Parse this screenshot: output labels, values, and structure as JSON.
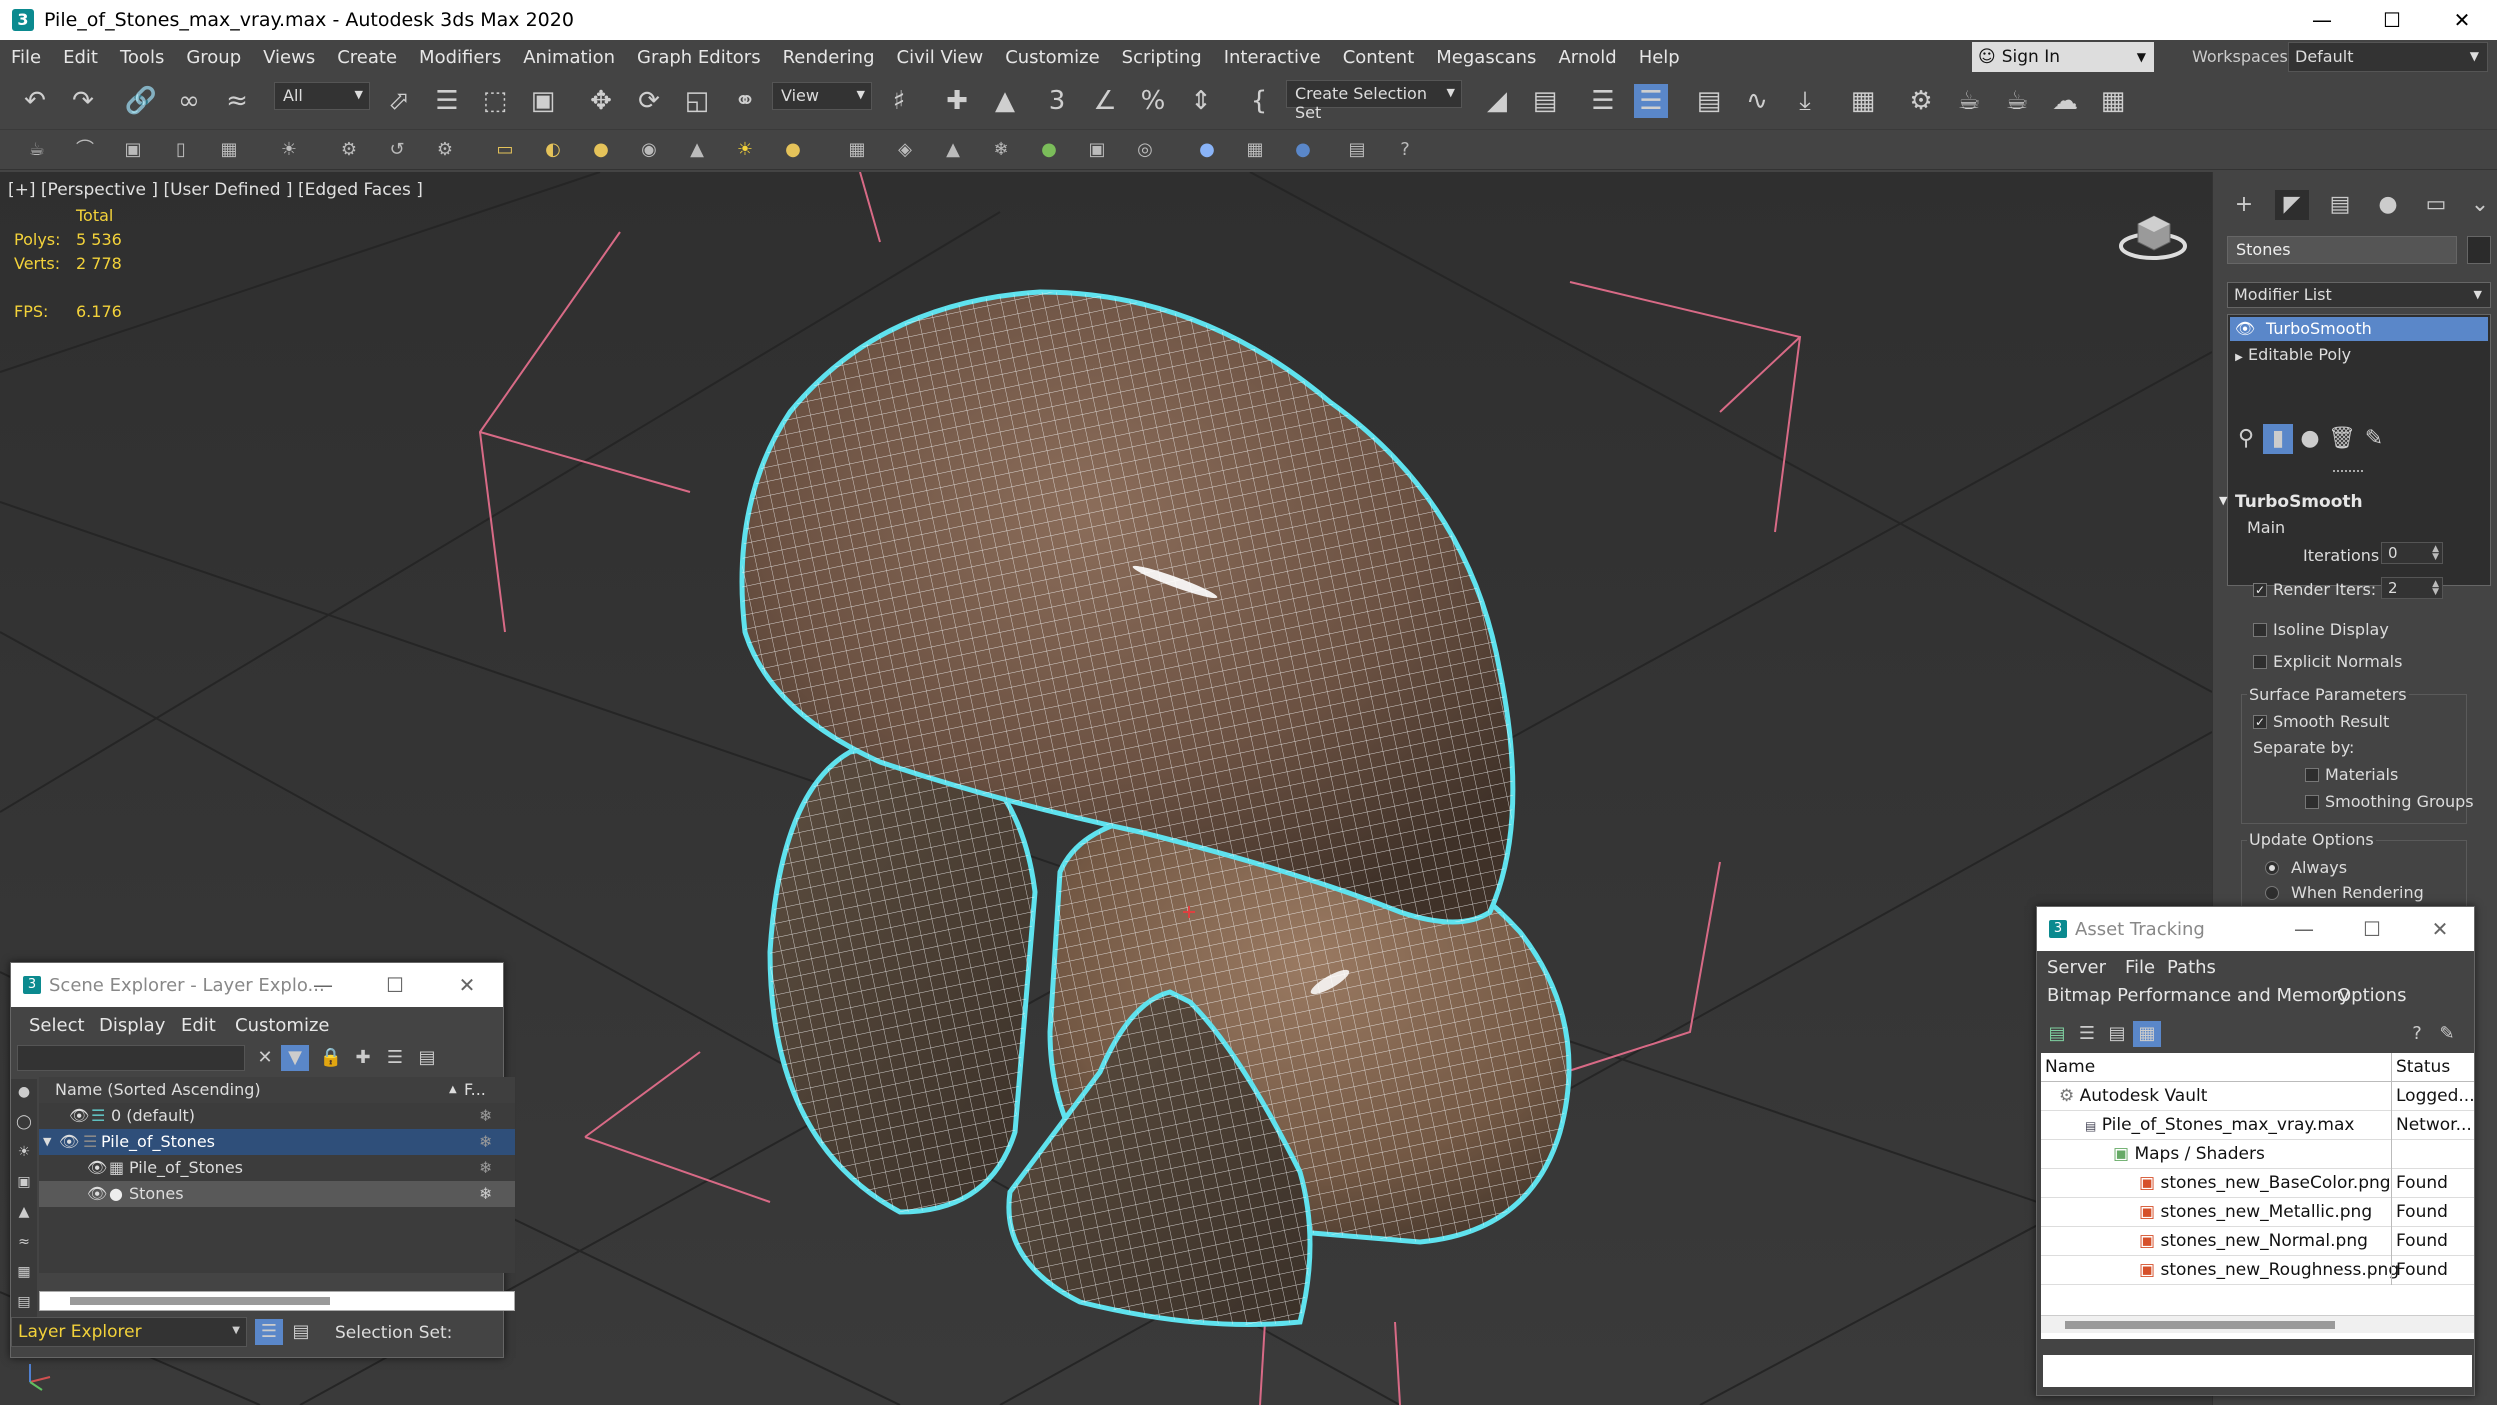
{
  "window": {
    "title": "Pile_of_Stones_max_vray.max - Autodesk 3ds Max 2020",
    "app_icon": "3"
  },
  "menu": [
    "File",
    "Edit",
    "Tools",
    "Group",
    "Views",
    "Create",
    "Modifiers",
    "Animation",
    "Graph Editors",
    "Rendering",
    "Civil View",
    "Customize",
    "Scripting",
    "Interactive",
    "Content",
    "Megascans",
    "Arnold",
    "Help"
  ],
  "signin": {
    "label": "Sign In"
  },
  "workspaces": {
    "label": "Workspaces:",
    "value": "Default"
  },
  "toolbar": {
    "selection_filter": "All",
    "ref_coord": "View",
    "selection_set": "Create Selection Set"
  },
  "viewport": {
    "label": "[+] [Perspective ] [User Defined ] [Edged Faces ]",
    "stats_header": "Total",
    "polys_label": "Polys:",
    "polys_value": "5 536",
    "verts_label": "Verts:",
    "verts_value": "2 778",
    "fps_label": "FPS:",
    "fps_value": "6.176"
  },
  "command_panel": {
    "object_name": "Stones",
    "modifier_list": "Modifier List",
    "stack": [
      "TurboSmooth",
      "Editable Poly"
    ],
    "rollout_title": "TurboSmooth",
    "main_label": "Main",
    "iterations_label": "Iterations:",
    "iterations_value": "0",
    "render_iters_label": "Render Iters:",
    "render_iters_value": "2",
    "isoline_label": "Isoline Display",
    "explicit_normals_label": "Explicit Normals",
    "surface_params_label": "Surface Parameters",
    "smooth_result_label": "Smooth Result",
    "separate_by_label": "Separate by:",
    "materials_label": "Materials",
    "smoothing_groups_label": "Smoothing Groups",
    "update_options_label": "Update Options",
    "always_label": "Always",
    "when_rendering_label": "When Rendering"
  },
  "scene_explorer": {
    "title": "Scene Explorer - Layer Explo...",
    "menu": [
      "Select",
      "Display",
      "Edit",
      "Customize"
    ],
    "column_name": "Name (Sorted Ascending)",
    "column_f": "F...",
    "rows": [
      "0 (default)",
      "Pile_of_Stones",
      "Pile_of_Stones",
      "Stones"
    ],
    "footer_dropdown": "Layer Explorer",
    "selection_set_label": "Selection Set:"
  },
  "asset_tracking": {
    "title": "Asset Tracking",
    "menu": [
      "Server",
      "File",
      "Paths",
      "Bitmap Performance and Memory",
      "Options"
    ],
    "col_name": "Name",
    "col_status": "Status",
    "rows": [
      {
        "name": "Autodesk Vault",
        "status": "Logged..."
      },
      {
        "name": "Pile_of_Stones_max_vray.max",
        "status": "Networ..."
      },
      {
        "name": "Maps / Shaders",
        "status": ""
      },
      {
        "name": "stones_new_BaseColor.png",
        "status": "Found"
      },
      {
        "name": "stones_new_Metallic.png",
        "status": "Found"
      },
      {
        "name": "stones_new_Normal.png",
        "status": "Found"
      },
      {
        "name": "stones_new_Roughness.png",
        "status": "Found"
      }
    ]
  },
  "colors": {
    "selection_outline": "#5fe2ee",
    "stats_yellow": "#f3d23a",
    "highlight_blue": "#5a87c9"
  }
}
